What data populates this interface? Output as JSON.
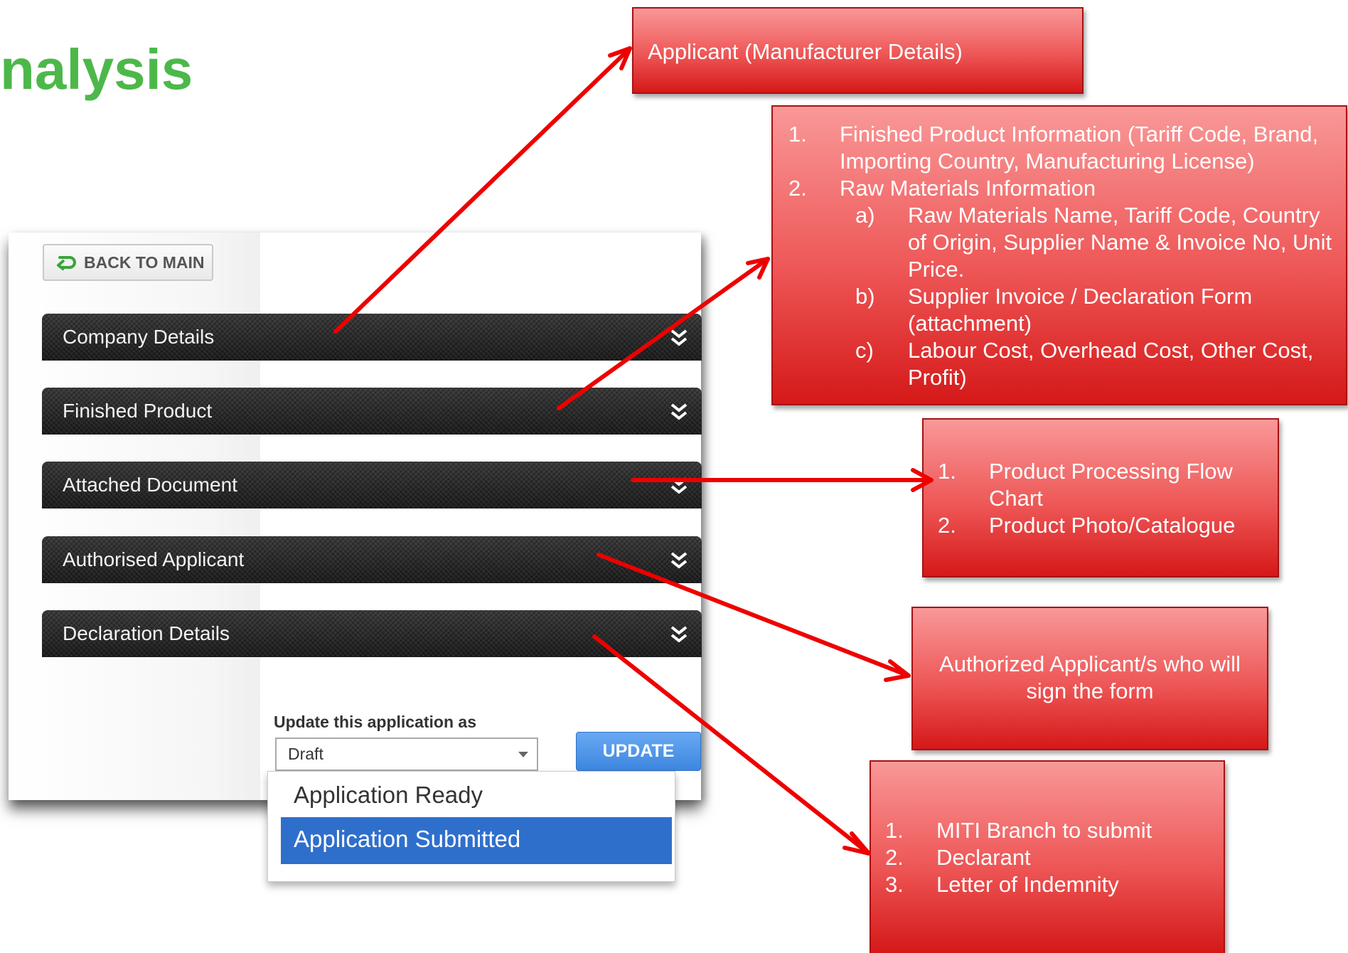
{
  "slide": {
    "title": "nalysis"
  },
  "app": {
    "back_button": {
      "label": "BACK TO MAIN",
      "icon": "back-arrow-icon"
    },
    "sections": [
      {
        "label": "Company Details",
        "icon": "double-chevron-down-icon"
      },
      {
        "label": "Finished Product",
        "icon": "double-chevron-down-icon"
      },
      {
        "label": "Attached Document",
        "icon": "double-chevron-down-icon"
      },
      {
        "label": "Authorised Applicant",
        "icon": "double-chevron-down-icon"
      },
      {
        "label": "Declaration Details",
        "icon": "double-chevron-down-icon"
      }
    ],
    "update_label": "Update this application as",
    "status_select": {
      "value": "Draft"
    },
    "update_button": "UPDATE",
    "dropdown_options": [
      {
        "label": "Application Ready",
        "selected": false
      },
      {
        "label": "Application Submitted",
        "selected": true
      }
    ]
  },
  "annotations": {
    "applicant": "Applicant (Manufacturer Details)",
    "finished_product": {
      "items": [
        {
          "num": "1.",
          "lines": [
            "Finished Product Information (Tariff Code, Brand,",
            "Importing Country, Manufacturing License)"
          ]
        },
        {
          "num": "2.",
          "lines": [
            "Raw Materials Information"
          ]
        }
      ],
      "subitems": [
        {
          "letter": "a)",
          "lines": [
            "Raw Materials Name, Tariff Code, Country",
            "of Origin, Supplier Name & Invoice No, Unit",
            "Price."
          ]
        },
        {
          "letter": "b)",
          "lines": [
            "Supplier Invoice / Declaration Form",
            "(attachment)"
          ]
        },
        {
          "letter": "c)",
          "lines": [
            "Labour Cost, Overhead Cost, Other Cost,",
            "Profit)"
          ]
        }
      ]
    },
    "attached_document": {
      "items": [
        {
          "num": "1.",
          "lines": [
            "Product Processing Flow",
            "Chart"
          ]
        },
        {
          "num": "2.",
          "lines": [
            "Product Photo/Catalogue"
          ]
        }
      ]
    },
    "authorised_applicant": [
      "Authorized Applicant/s who will",
      "sign the form"
    ],
    "declaration": {
      "items": [
        {
          "num": "1.",
          "lines": [
            "MITI Branch to submit"
          ]
        },
        {
          "num": "2.",
          "lines": [
            "Declarant"
          ]
        },
        {
          "num": "3.",
          "lines": [
            "Letter of Indemnity"
          ]
        }
      ]
    }
  },
  "colors": {
    "title_green": "#4db84a",
    "note_red": "#e83a3a",
    "arrow_red": "#ee0000",
    "update_blue": "#3d86e0",
    "selected_blue": "#2f6fcc"
  }
}
